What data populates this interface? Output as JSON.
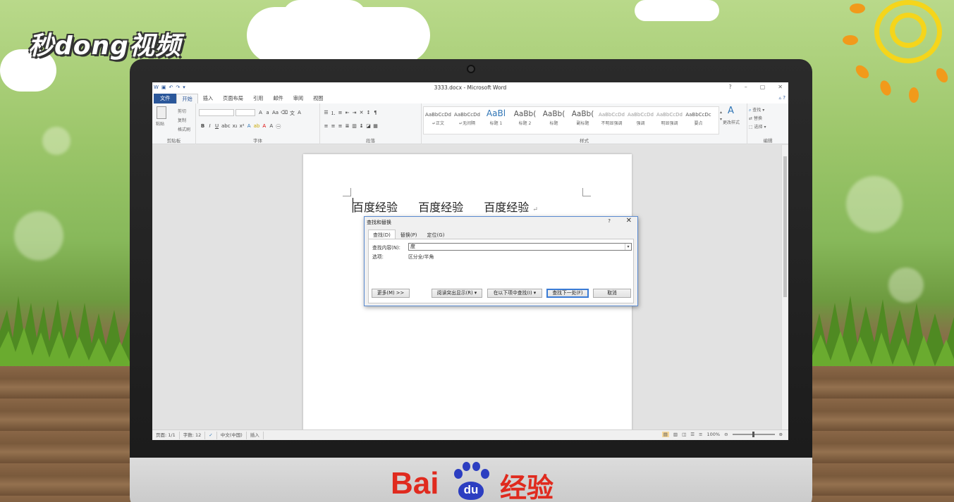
{
  "watermark": {
    "brand": "秒dong视频",
    "footer_brand_latin": "Bai",
    "footer_brand_paw": "du",
    "footer_brand_cn": "经验"
  },
  "window": {
    "title": "3333.docx - Microsoft Word",
    "controls": [
      "?",
      "–",
      "▢",
      "✕"
    ]
  },
  "ribbon": {
    "tabs": [
      "文件",
      "开始",
      "插入",
      "页面布局",
      "引用",
      "邮件",
      "审阅",
      "视图"
    ],
    "active_tab": "开始",
    "clipboard": {
      "label": "剪贴板",
      "paste": "粘贴",
      "cut": "剪切",
      "copy": "复制",
      "format_painter": "格式刷"
    },
    "font": {
      "label": "字体"
    },
    "paragraph": {
      "label": "段落"
    },
    "styles": {
      "label": "样式",
      "items": [
        {
          "sample": "AaBbCcDd",
          "name": "↵正文"
        },
        {
          "sample": "AaBbCcDd",
          "name": "↵无间隔"
        },
        {
          "sample": "AaBl",
          "name": "标题 1"
        },
        {
          "sample": "AaBb(",
          "name": "标题 2"
        },
        {
          "sample": "AaBb(",
          "name": "标题"
        },
        {
          "sample": "AaBb(",
          "name": "副标题"
        },
        {
          "sample": "AaBbCcDd",
          "name": "不明显强调"
        },
        {
          "sample": "AaBbCcDd",
          "name": "强调"
        },
        {
          "sample": "AaBbCcDd",
          "name": "明显强调"
        },
        {
          "sample": "AaBbCcDc",
          "name": "要点"
        }
      ],
      "change_styles": "更改样式"
    },
    "editing": {
      "label": "编辑",
      "find": "查找",
      "replace": "替换",
      "select": "选择"
    }
  },
  "document": {
    "words": [
      "百度经验",
      "百度经验",
      "百度经验"
    ],
    "end_mark": "↵"
  },
  "dialog": {
    "title": "查找和替换",
    "help": "?",
    "close": "✕",
    "tabs": [
      "查找(D)",
      "替换(P)",
      "定位(G)"
    ],
    "active_tab": "查找(D)",
    "find_label": "查找内容(N):",
    "find_value": "度",
    "options_label": "选项:",
    "options_value": "区分全/半角",
    "buttons": {
      "more": "更多(M) >>",
      "reading_highlight": "阅读突出显示(R) ▾",
      "find_in": "在以下项中查找(I) ▾",
      "find_next": "查找下一处(F)",
      "cancel": "取消"
    }
  },
  "statusbar": {
    "page": "页面: 1/1",
    "words": "字数: 12",
    "language": "中文(中国)",
    "mode": "插入",
    "zoom": "100%"
  }
}
